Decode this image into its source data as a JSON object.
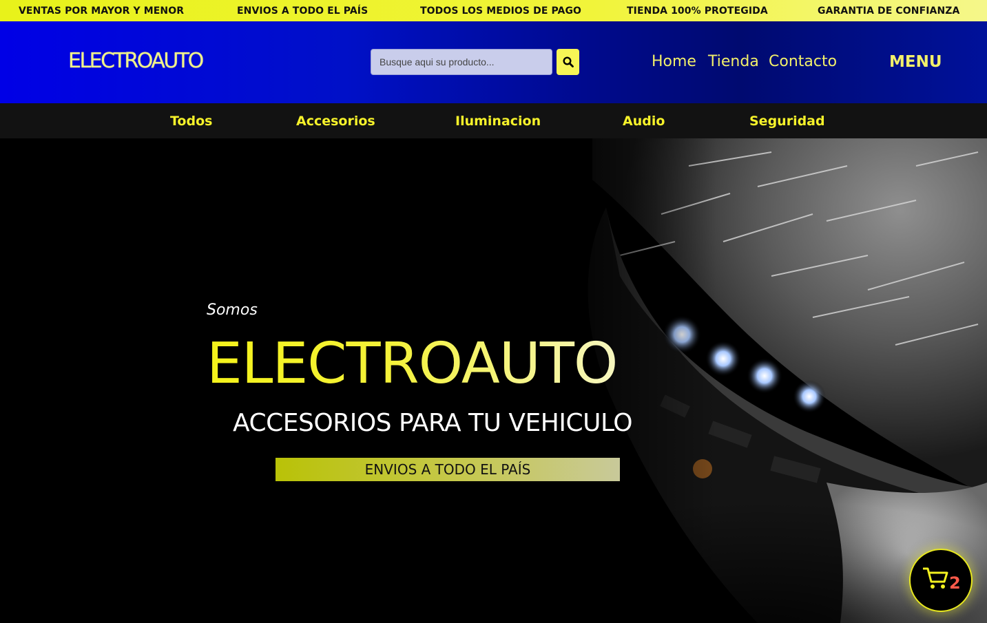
{
  "topbar": {
    "items": [
      "VENTAS POR MAYOR Y MENOR",
      "ENVIOS A TODO EL PAÍS",
      "TODOS LOS MEDIOS DE PAGO",
      "TIENDA 100% PROTEGIDA",
      "GARANTIA DE CONFIANZA"
    ]
  },
  "header": {
    "logo": "ELECTROAUTO",
    "search_placeholder": "Busque aqui su producto...",
    "nav": [
      "Home",
      "Tienda",
      "Contacto"
    ],
    "menu_label": "MENU"
  },
  "categories": [
    "Todos",
    "Accesorios",
    "Iluminacion",
    "Audio",
    "Seguridad"
  ],
  "hero": {
    "intro": "Somos",
    "brand": "ELECTROAUTO",
    "tagline": "ACCESORIOS PARA TU VEHICULO",
    "shipping": "ENVIOS A TODO EL PAÍS"
  },
  "cart": {
    "count": "2",
    "icon": "cart-icon"
  },
  "colors": {
    "accent_yellow": "#f6f22a",
    "header_blue": "#0000e6",
    "cart_badge": "#ff5a4a"
  }
}
